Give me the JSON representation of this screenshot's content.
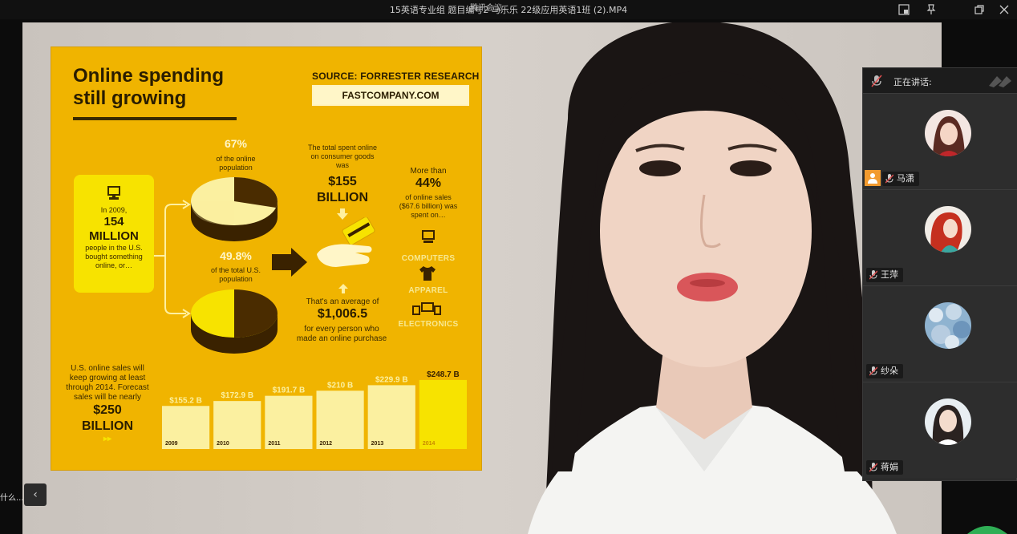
{
  "window": {
    "title": "15英语专业组  题目编号2  马乐乐  22级应用英语1班 (2).MP4",
    "app_name": "腾讯会议"
  },
  "infographic": {
    "headline_line1": "Online spending",
    "headline_line2": "still growing",
    "source": "SOURCE: FORRESTER RESEARCH",
    "website": "FASTCOMPANY.COM",
    "stat_box": {
      "line1": "In 2009,",
      "number": "154",
      "unit": "MILLION",
      "line2": "people in the U.S.",
      "line3": "bought something",
      "line4": "online, or…"
    },
    "pct1": "67%",
    "pct1_label_line1": "of the online",
    "pct1_label_line2": "population",
    "pct2": "49.8%",
    "pct2_label_line1": "of the total U.S.",
    "pct2_label_line2": "population",
    "spent_line1": "The total spent online",
    "spent_line2": "on consumer goods",
    "spent_line3": "was",
    "spent_value_line1": "$155",
    "spent_value_line2": "BILLION",
    "avg_line1": "That's an average of",
    "avg_value": "$1,006.5",
    "avg_line2": "for every person who",
    "avg_line3": "made an online purchase",
    "more_than": "More than",
    "pct3": "44%",
    "pct3_line1": "of online sales",
    "pct3_line2": "($67.6 billion) was",
    "pct3_line3": "spent on…",
    "categories": [
      "COMPUTERS",
      "APPAREL",
      "ELECTRONICS"
    ],
    "forecast": {
      "line1": "U.S. online sales will",
      "line2": "keep growing at least",
      "line3": "through 2014. Forecast",
      "line4": "sales will be nearly",
      "value_line1": "$250",
      "value_line2": "BILLION",
      "arrows": "▸▸"
    }
  },
  "chart_data": {
    "type": "bar",
    "categories": [
      "2009",
      "2010",
      "2011",
      "2012",
      "2013",
      "2014"
    ],
    "values": [
      155.2,
      172.9,
      191.7,
      210,
      229.9,
      248.7
    ],
    "value_labels": [
      "$155.2 B",
      "$172.9 B",
      "$191.7 B",
      "$210 B",
      "$229.9 B",
      "$248.7 B"
    ],
    "ylim": [
      0,
      260
    ],
    "colors": {
      "normal": "#fbf0a0",
      "highlight": "#f7e300"
    }
  },
  "sidebar_peek": {
    "chat_text": "什么...",
    "collapse_glyph": "‹"
  },
  "participants": {
    "speaking_label": "正在讲话:",
    "tiles": [
      {
        "name": "马潇",
        "host": true
      },
      {
        "name": "王萍",
        "host": false
      },
      {
        "name": "纱朵",
        "host": false
      },
      {
        "name": "蒋娟",
        "host": false
      }
    ]
  },
  "colors": {
    "slide_bg": "#f0b400",
    "panel_bg": "#2b2b2b",
    "host_badge": "#f29a2e"
  }
}
